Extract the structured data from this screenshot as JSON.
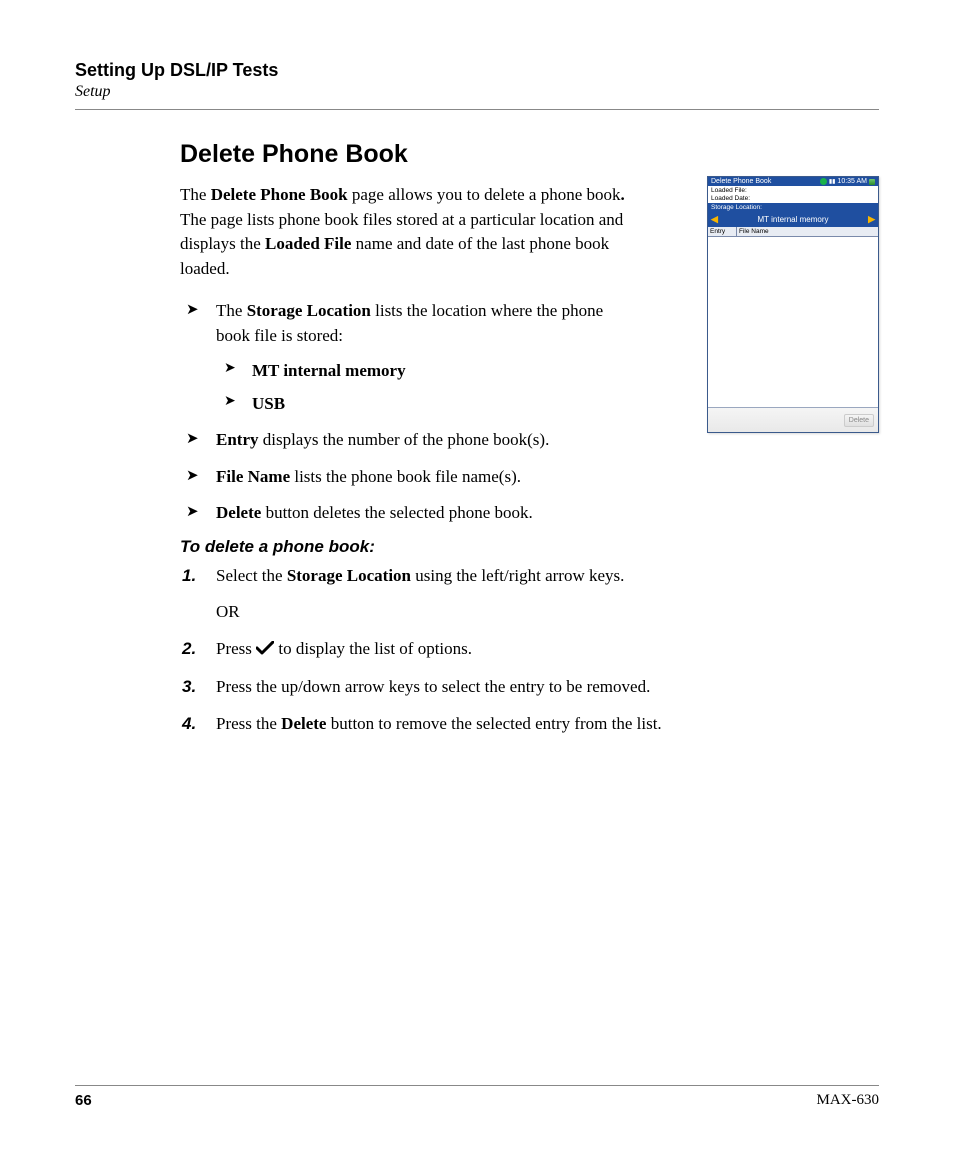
{
  "header": {
    "chapter": "Setting Up DSL/IP Tests",
    "section": "Setup"
  },
  "title": "Delete Phone Book",
  "intro": {
    "t1": "The ",
    "b1": "Delete Phone Book",
    "t2": " page allows you to delete a phone book",
    "dot": ".",
    "t3": " The page lists phone book files stored at a particular location and displays the ",
    "b2": "Loaded File",
    "t4": " name and date of the last phone book loaded."
  },
  "bullets1": {
    "i1_t1": "The ",
    "i1_b1": "Storage Location",
    "i1_t2": " lists the location where the phone book file is stored:",
    "sub1": "MT internal memory",
    "sub2": "USB",
    "i2_b1": "Entry",
    "i2_t1": " displays the number of the phone book(s).",
    "i3_b1": "File Name",
    "i3_t1": " lists the phone book file name(s).",
    "i4_b1": "Delete",
    "i4_t1": " button deletes the selected phone book."
  },
  "subhead": "To delete a phone book:",
  "steps": {
    "s1_t1": "Select the ",
    "s1_b1": "Storage Location",
    "s1_t2": " using the left/right arrow keys.",
    "s1_or": "OR",
    "s2_t1": "Press ",
    "s2_t2": " to display the list of options.",
    "s3": "Press the up/down arrow keys to select the entry to be removed.",
    "s4_t1": "Press the ",
    "s4_b1": "Delete",
    "s4_t2": " button to remove the selected entry from the list."
  },
  "screenshot": {
    "title": "Delete Phone Book",
    "time": "10:35 AM",
    "loaded_file_lbl": "Loaded File:",
    "loaded_date_lbl": "Loaded Date:",
    "storage_lbl": "Storage Location:",
    "storage_value": "MT internal memory",
    "col_entry": "Entry",
    "col_file": "File Name",
    "delete_btn": "Delete"
  },
  "footer": {
    "page": "66",
    "model": "MAX-630"
  }
}
